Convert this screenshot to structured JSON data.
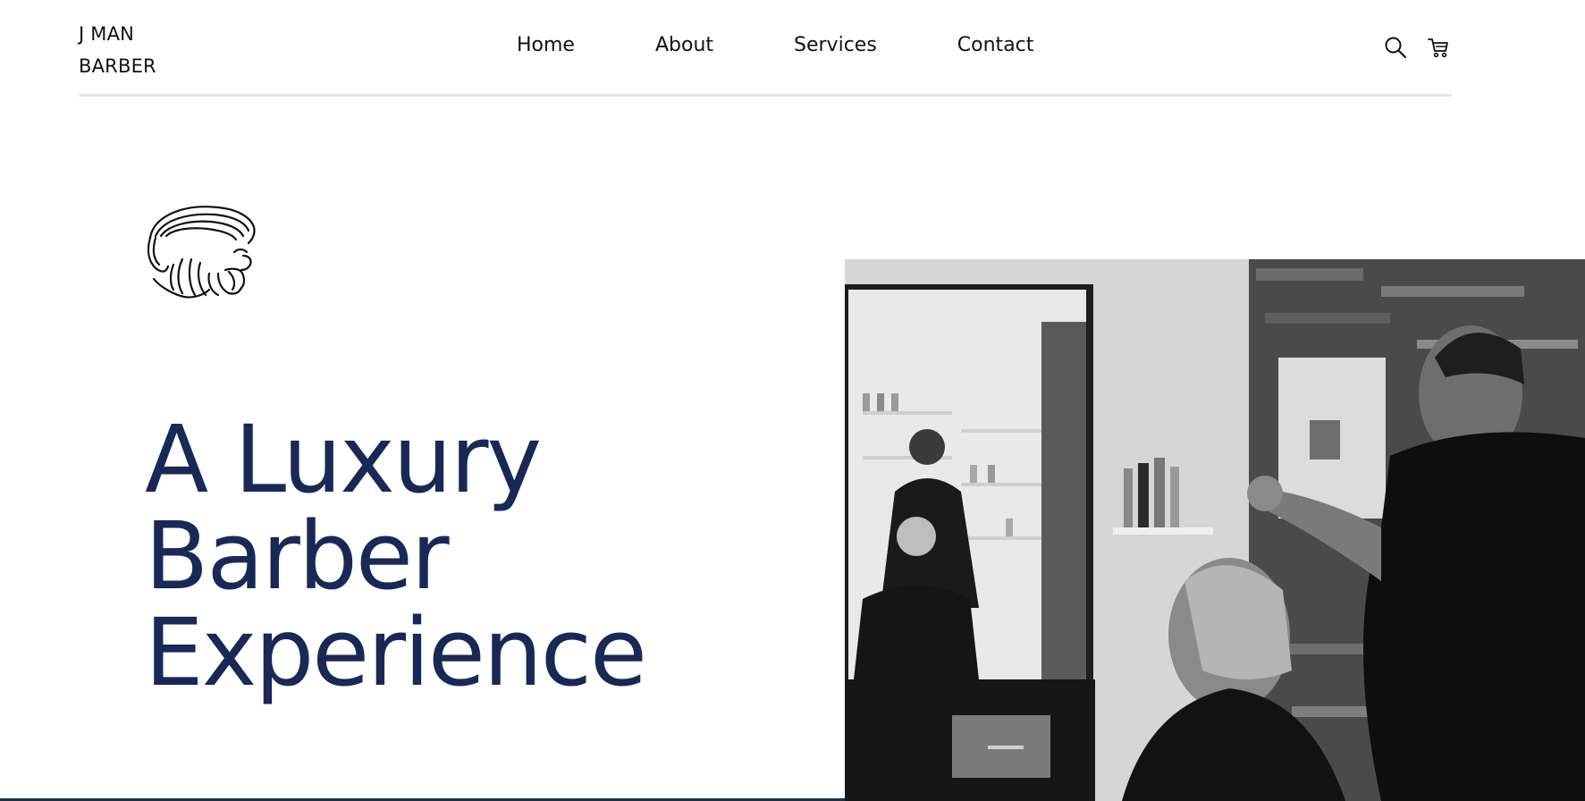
{
  "header": {
    "logo_line1": "J MAN",
    "logo_line2": "BARBER",
    "nav": [
      {
        "label": "Home"
      },
      {
        "label": "About"
      },
      {
        "label": "Services"
      },
      {
        "label": "Contact"
      }
    ],
    "icons": [
      "search-icon",
      "cart-icon"
    ]
  },
  "hero": {
    "title_line1": "A Luxury",
    "title_line2": "Barber",
    "title_line3": "Experience",
    "title_color": "#1a2855",
    "logo_icon": "barber-head-icon",
    "photo": "barber-cutting-hair-photo"
  }
}
